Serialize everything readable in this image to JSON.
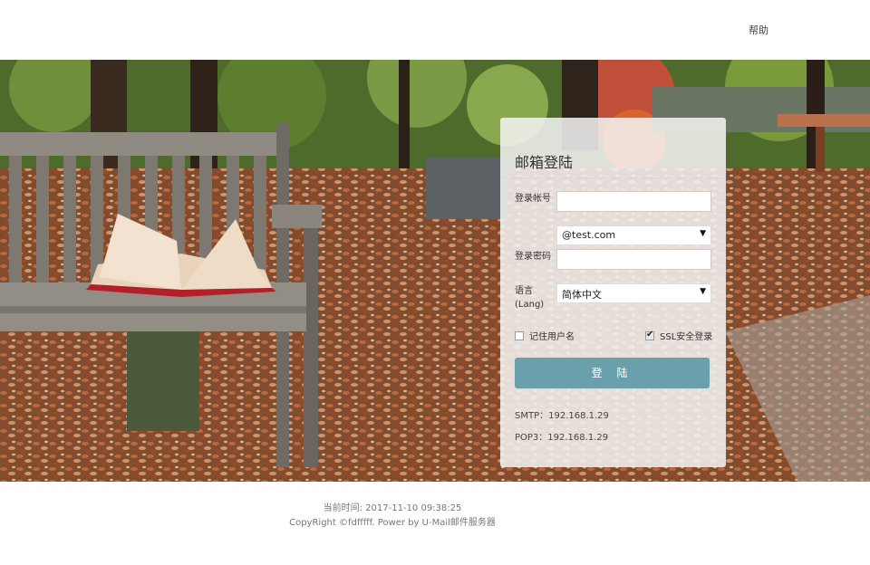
{
  "header": {
    "help_label": "帮助"
  },
  "login": {
    "title": "邮箱登陆",
    "account_label": "登录帐号",
    "account_value": "",
    "domain_selected": "@test.com",
    "password_label": "登录密码",
    "password_value": "",
    "language_label_line1": "语言",
    "language_label_line2": "(Lang)",
    "language_selected": "简体中文",
    "remember_label": "记住用户名",
    "remember_checked": false,
    "ssl_label": "SSL安全登录",
    "ssl_checked": true,
    "submit_label": "登 陆",
    "smtp_text": "SMTP：192.168.1.29",
    "pop3_text": "POP3：192.168.1.29"
  },
  "footer": {
    "current_time": "当前时间: 2017-11-10 09:38:25",
    "copyright": "CopyRight ©fdfffff. Power by U-Mail邮件服务器"
  },
  "colors": {
    "button": "#6aa0ab",
    "panel": "#f5f5f5"
  }
}
